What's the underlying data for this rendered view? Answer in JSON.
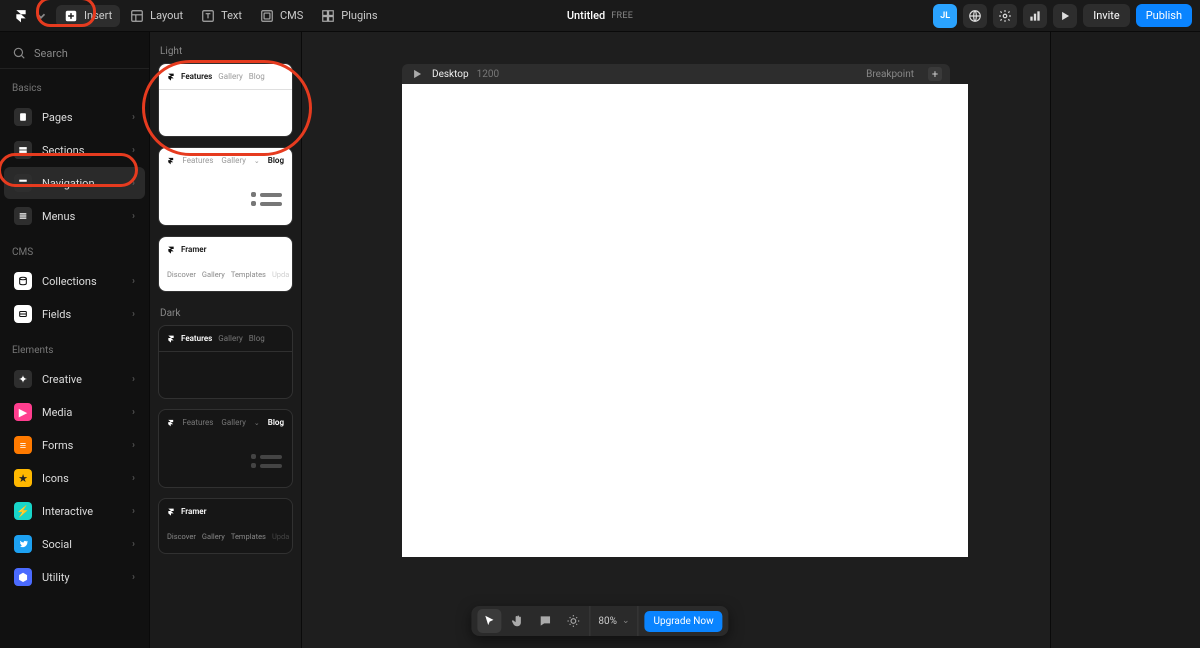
{
  "topbar": {
    "items": [
      {
        "id": "insert",
        "label": "Insert"
      },
      {
        "id": "layout",
        "label": "Layout"
      },
      {
        "id": "text",
        "label": "Text"
      },
      {
        "id": "cms",
        "label": "CMS"
      },
      {
        "id": "plugins",
        "label": "Plugins"
      }
    ],
    "doc_title": "Untitled",
    "doc_badge": "FREE",
    "user_initials": "JL",
    "invite_label": "Invite",
    "publish_label": "Publish"
  },
  "sidebar": {
    "search_label": "Search",
    "groups": [
      {
        "title": "Basics",
        "items": [
          {
            "label": "Pages"
          },
          {
            "label": "Sections"
          },
          {
            "label": "Navigation"
          },
          {
            "label": "Menus"
          }
        ]
      },
      {
        "title": "CMS",
        "items": [
          {
            "label": "Collections"
          },
          {
            "label": "Fields"
          }
        ]
      },
      {
        "title": "Elements",
        "items": [
          {
            "label": "Creative"
          },
          {
            "label": "Media"
          },
          {
            "label": "Forms"
          },
          {
            "label": "Icons"
          },
          {
            "label": "Interactive"
          },
          {
            "label": "Social"
          },
          {
            "label": "Utility"
          }
        ]
      }
    ]
  },
  "components": {
    "light_label": "Light",
    "dark_label": "Dark",
    "nav_a": {
      "t1": "Features",
      "t2": "Gallery",
      "t3": "Blog"
    },
    "nav_b": {
      "t1": "Features",
      "t2": "Gallery",
      "t3": "Blog"
    },
    "nav_c": {
      "brand": "Framer",
      "t1": "Discover",
      "t2": "Gallery",
      "t3": "Templates",
      "t4": "Upda"
    }
  },
  "canvas": {
    "frame_label": "Desktop",
    "frame_width": "1200",
    "breakpoint_label": "Breakpoint"
  },
  "bottombar": {
    "zoom": "80%",
    "upgrade": "Upgrade Now"
  }
}
